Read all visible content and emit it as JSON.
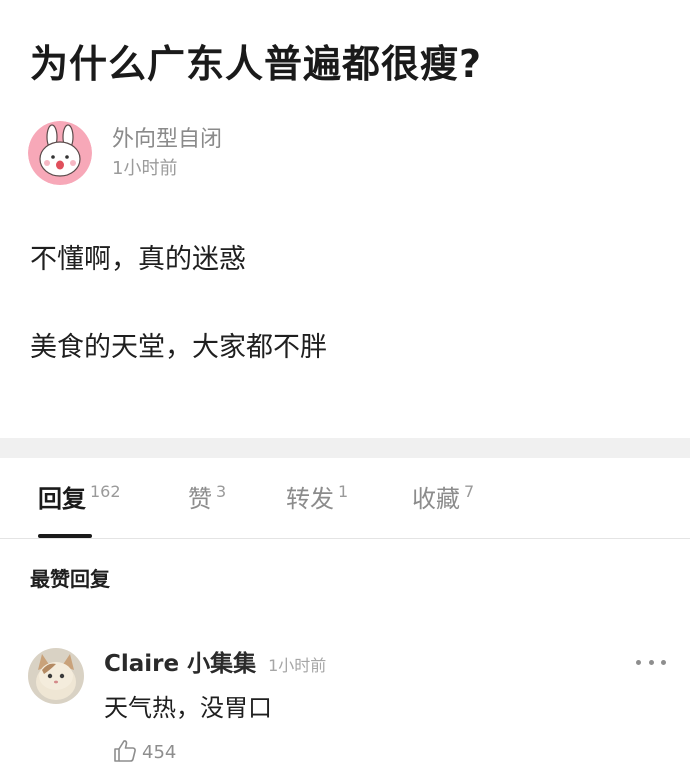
{
  "post": {
    "title": "为什么广东人普遍都很瘦?",
    "author": {
      "name": "外向型自闭",
      "time": "1小时前",
      "avatar_icon": "bunny-avatar-icon"
    },
    "body_lines": [
      "不懂啊，真的迷惑",
      "美食的天堂，大家都不胖"
    ]
  },
  "tabs": [
    {
      "label": "回复",
      "count": "162",
      "active": true
    },
    {
      "label": "赞",
      "count": "3",
      "active": false
    },
    {
      "label": "转发",
      "count": "1",
      "active": false
    },
    {
      "label": "收藏",
      "count": "7",
      "active": false
    }
  ],
  "section": {
    "heading": "最赞回复"
  },
  "comment": {
    "user": "Claire 小集集",
    "time": "1小时前",
    "text": "天气热，没胃口",
    "likes": "454",
    "avatar_icon": "cat-avatar-icon",
    "more_icon": "more-dots-icon",
    "like_icon": "thumbs-up-icon"
  },
  "colors": {
    "divider_band": "#f0f0f0",
    "active_tab": "#1a1a1a",
    "inactive_tab": "#8c8c8c",
    "avatar_pink": "#f7a8b8"
  }
}
